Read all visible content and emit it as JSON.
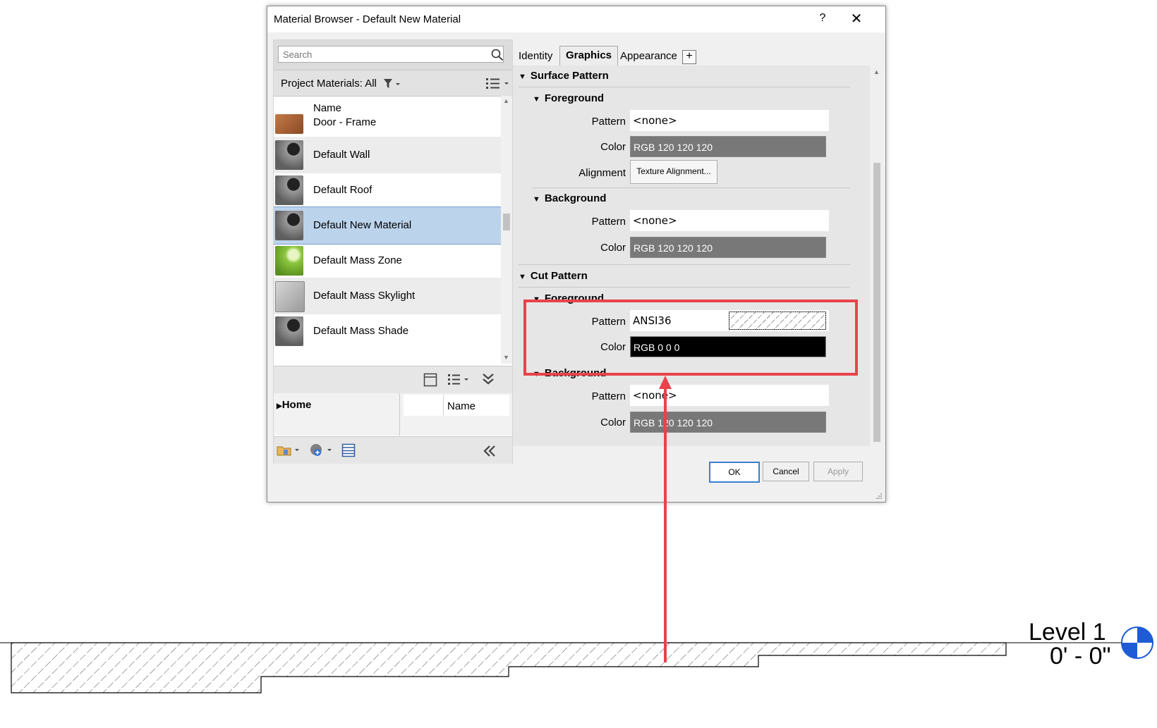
{
  "dialog": {
    "title": "Material Browser - Default New Material",
    "help_label": "?",
    "close_label": "✕"
  },
  "left": {
    "search_placeholder": "Search",
    "project_materials_label": "Project Materials: All",
    "name_header": "Name",
    "materials": [
      {
        "name": "Door - Frame",
        "color": "#b8693a"
      },
      {
        "name": "Default Wall",
        "color": "#7a7a7a"
      },
      {
        "name": "Default Roof",
        "color": "#7a7a7a"
      },
      {
        "name": "Default New Material",
        "color": "#7a7a7a"
      },
      {
        "name": "Default Mass Zone",
        "color": "#8cc63f"
      },
      {
        "name": "Default Mass Skylight",
        "color": "#b9b9b9"
      },
      {
        "name": "Default Mass Shade",
        "color": "#7a7a7a"
      }
    ],
    "library_home": "Home",
    "library_name_header": "Name"
  },
  "tabs": {
    "identity": "Identity",
    "graphics": "Graphics",
    "appearance": "Appearance",
    "add": "+"
  },
  "graphics": {
    "surface_pattern": {
      "title": "Surface Pattern",
      "foreground": {
        "title": "Foreground",
        "pattern_label": "Pattern",
        "pattern_value": "<none>",
        "color_label": "Color",
        "color_value": "RGB 120 120 120",
        "alignment_label": "Alignment",
        "alignment_button": "Texture Alignment..."
      },
      "background": {
        "title": "Background",
        "pattern_label": "Pattern",
        "pattern_value": "<none>",
        "color_label": "Color",
        "color_value": "RGB 120 120 120"
      }
    },
    "cut_pattern": {
      "title": "Cut Pattern",
      "foreground": {
        "title": "Foreground",
        "pattern_label": "Pattern",
        "pattern_value": "ANSI36",
        "color_label": "Color",
        "color_value": "RGB 0 0 0"
      },
      "background": {
        "title": "Background",
        "pattern_label": "Pattern",
        "pattern_value": "<none>",
        "color_label": "Color",
        "color_value": "RGB 120 120 120"
      }
    }
  },
  "buttons": {
    "ok": "OK",
    "cancel": "Cancel",
    "apply": "Apply"
  },
  "level": {
    "name": "Level 1",
    "elevation": "0' - 0\""
  },
  "colors": {
    "highlight": "#e8434b",
    "gray_swatch": "#787878",
    "black_swatch": "#000000",
    "selection": "#bcd3ec",
    "level_marker": "#1f5bd6"
  }
}
